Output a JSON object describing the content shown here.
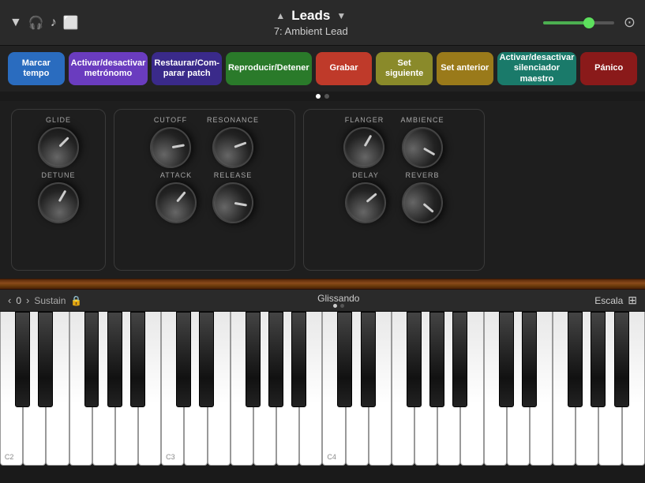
{
  "topbar": {
    "patch_name": "Leads",
    "patch_sub": "7: Ambient Lead",
    "nav_up": "▲",
    "nav_down": "▼"
  },
  "buttons": [
    {
      "label": "Marcar tempo",
      "color": "btn-blue",
      "name": "tap-tempo-button"
    },
    {
      "label": "Activar/desactivar metrónomo",
      "color": "btn-purple",
      "name": "toggle-metronome-button"
    },
    {
      "label": "Restaurar/Com-parar patch",
      "color": "btn-darkpurple",
      "name": "restore-patch-button"
    },
    {
      "label": "Reproducir/Detener",
      "color": "btn-green",
      "name": "play-stop-button"
    },
    {
      "label": "Grabar",
      "color": "btn-red",
      "name": "record-button"
    },
    {
      "label": "Set siguiente",
      "color": "btn-olive",
      "name": "next-set-button"
    },
    {
      "label": "Set anterior",
      "color": "btn-darkyellow",
      "name": "prev-set-button"
    },
    {
      "label": "Activar/desactivar silenciador maestro",
      "color": "btn-teal",
      "name": "master-mute-button"
    },
    {
      "label": "Pánico",
      "color": "btn-darkred",
      "name": "panic-button"
    }
  ],
  "synth": {
    "group1": {
      "knobs": [
        {
          "label": "GLIDE",
          "pos": "pos-glide"
        },
        {
          "label": "DETUNE",
          "pos": "pos-detune"
        }
      ]
    },
    "group2": {
      "knobs": [
        {
          "label": "CUTOFF",
          "pos": "pos-cutoff"
        },
        {
          "label": "RESONANCE",
          "pos": "pos-resonance"
        },
        {
          "label": "ATTACK",
          "pos": "pos-attack"
        },
        {
          "label": "RELEASE",
          "pos": "pos-release"
        }
      ]
    },
    "group3": {
      "knobs": [
        {
          "label": "FLANGER",
          "pos": "pos-flanger"
        },
        {
          "label": "AMBIENCE",
          "pos": "pos-ambience"
        },
        {
          "label": "DELAY",
          "pos": "pos-delay"
        },
        {
          "label": "REVERB",
          "pos": "pos-reverb"
        }
      ]
    }
  },
  "keyboard": {
    "octave": "0",
    "sustain_label": "Sustain",
    "glissando_label": "Glissando",
    "scala_label": "Escala",
    "octave_labels": [
      "C2",
      "C3",
      "C4"
    ]
  }
}
